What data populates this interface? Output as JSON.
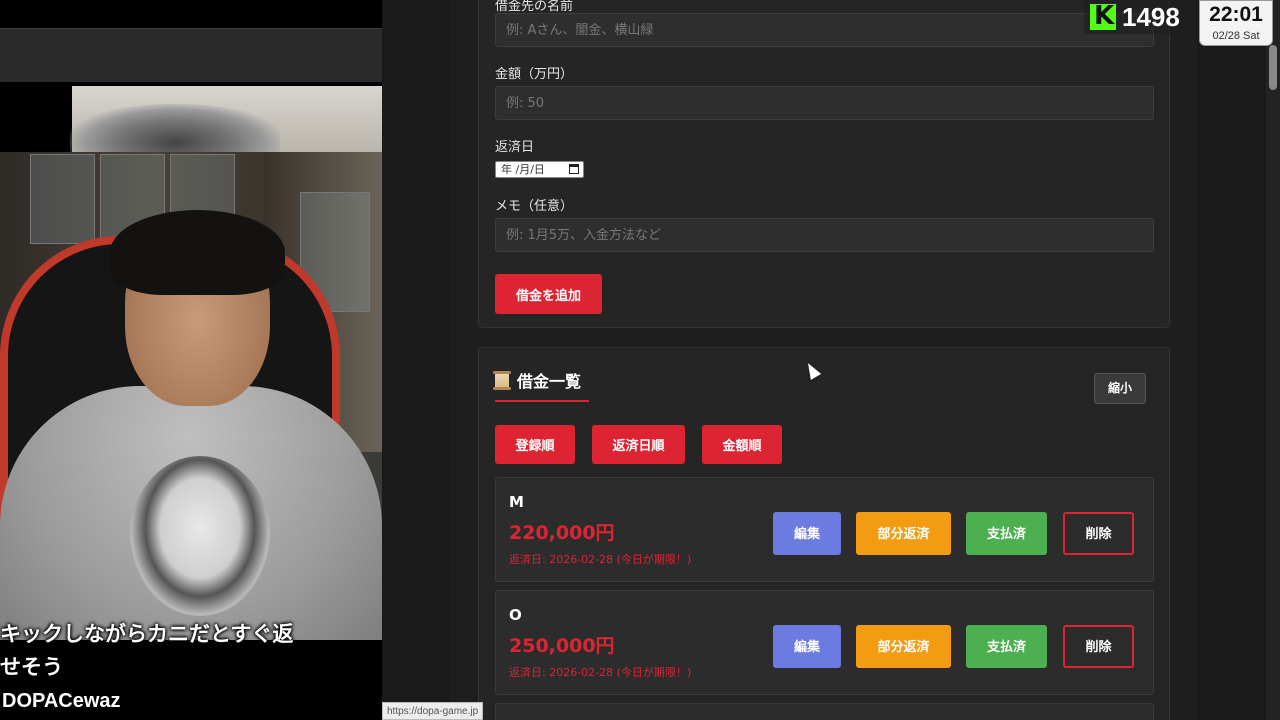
{
  "form": {
    "creditor_label": "借金先の名前",
    "creditor_placeholder": "例: Aさん、闇金、横山緑",
    "amount_label": "金額（万円）",
    "amount_placeholder": "例: 50",
    "due_label": "返済日",
    "due_placeholder": "年 /月/日",
    "memo_label": "メモ（任意）",
    "memo_placeholder": "例: 1月5万、入金方法など",
    "add_button": "借金を追加"
  },
  "list": {
    "title": "借金一覧",
    "collapse_button": "縮小",
    "sort_buttons": [
      "登録順",
      "返済日順",
      "金額順"
    ],
    "items": [
      {
        "name": "M",
        "amount": "220,000円",
        "due": "返済日: 2026-02-28 (今日が期限！)"
      },
      {
        "name": "O",
        "amount": "250,000円",
        "due": "返済日: 2026-02-28 (今日が期限！)"
      }
    ],
    "actions": {
      "edit": "編集",
      "partial": "部分返済",
      "paid": "支払済",
      "delete": "削除"
    }
  },
  "overlay": {
    "caption_line1": "キックしながらカニだとすぐ返",
    "caption_line2": "せそう",
    "streamer_name": "DOPACewaz",
    "viewer_count": "1498",
    "clock_time": "22:01",
    "clock_date": "02/28 Sat",
    "status_url": "https://dopa-game.jp"
  },
  "colors": {
    "accent_red": "#dc2433",
    "edit_blue": "#6c7be0",
    "partial_orange": "#f39c12",
    "paid_green": "#4caf50",
    "kick_green": "#53fc18"
  }
}
